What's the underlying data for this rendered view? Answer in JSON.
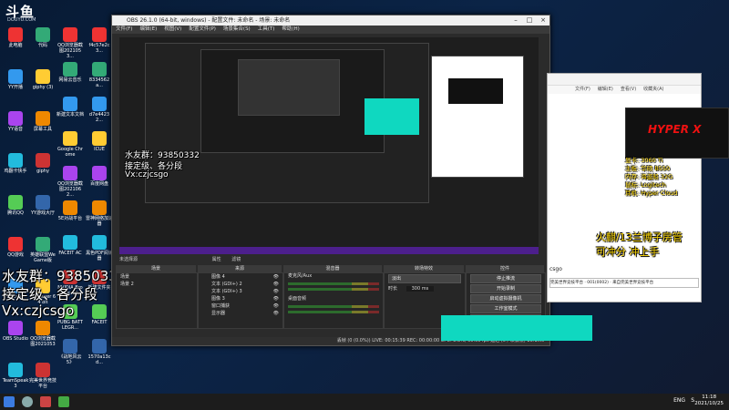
{
  "watermark": {
    "logo": "斗鱼",
    "domain": "DOUYU.COM"
  },
  "desktop_icons": [
    {
      "label": "此电脑"
    },
    {
      "label": "代码"
    },
    {
      "label": "YY开播"
    },
    {
      "label": "giphy (3)"
    },
    {
      "label": "YY语音"
    },
    {
      "label": "屏幕工具"
    },
    {
      "label": "鸡翻卡快手"
    },
    {
      "label": "giphy"
    },
    {
      "label": "腾讯QQ"
    },
    {
      "label": "YY游戏大厅"
    },
    {
      "label": "QQ游戏"
    },
    {
      "label": "英雄联盟WeGame版"
    },
    {
      "label": "Steam"
    },
    {
      "label": "PotPlayer 64 bit"
    },
    {
      "label": "OBS Studio"
    },
    {
      "label": "QQ浏览器截图2021053"
    },
    {
      "label": "TeamSpeak 3"
    },
    {
      "label": "完美世界竞技平台"
    }
  ],
  "desktop_icons_col3": [
    {
      "label": "QQ浏览器截图2021053..."
    },
    {
      "label": "网易云音乐"
    },
    {
      "label": "新建文本文档"
    },
    {
      "label": "Google Chrome"
    },
    {
      "label": "QQ浏览器截图2021062..."
    },
    {
      "label": "5E对战平台"
    },
    {
      "label": "FACEIT AC"
    },
    {
      "label": "NVIDIA Broadcast"
    },
    {
      "label": "PUBG BATTLEGR..."
    },
    {
      "label": "《战地风云 5》"
    }
  ],
  "desktop_icons_col4": [
    {
      "label": "f4c57e2c3..."
    },
    {
      "label": "8334562a..."
    },
    {
      "label": "d7e44232..."
    },
    {
      "label": "ICUE"
    },
    {
      "label": "百度网盘"
    },
    {
      "label": "雷神网络加速器"
    },
    {
      "label": "黑色PDF阅读器"
    },
    {
      "label": "新建文件夹"
    },
    {
      "label": "FACEIT"
    },
    {
      "label": "1570a13cd..."
    }
  ],
  "obs": {
    "title": "OBS 26.1.0 (64-bit, windows) - 配置文件: 未命名 - 场景: 未命名",
    "menu": [
      "文件(F)",
      "编辑(E)",
      "视图(V)",
      "配置文件(P)",
      "场景集合(S)",
      "工具(T)",
      "帮助(H)"
    ],
    "docks": {
      "scenes": "场景",
      "sources": "来源",
      "mixer": "混音器",
      "transitions": "转场特效",
      "controls": "控件"
    },
    "scene_bar_label": "未选择源",
    "scenes": [
      "场景",
      "场景 2"
    ],
    "sources": [
      "图像 4",
      "文本 (GDI+) 2",
      "文本 (GDI+) 3",
      "图像 3",
      "窗口捕获",
      "显示器"
    ],
    "toolbar": [
      "属性",
      "滤镜"
    ],
    "mixer": [
      {
        "name": "麦克风/Aux",
        "level": "0.0 dB"
      },
      {
        "name": "桌面音频",
        "level": "0.0 dB"
      }
    ],
    "transition": {
      "type": "淡出",
      "duration_label": "时长",
      "duration": "300 ms"
    },
    "controls": [
      "停止推流",
      "开始录制",
      "启动虚拟摄像机",
      "工作室模式",
      "设置",
      "退出"
    ],
    "status": "丢帧 (0 (0.0%))  LIVE: 00:15:39  REC: 00:00:00  CPU: 8.3%, 60.00 fps  延迟 (0 / 以丢帧) 16:1ms"
  },
  "overlay_left": {
    "line1": "水友群：93850332",
    "line2": "接定级、各分段",
    "line3": "Vx:czjcsgo"
  },
  "overlay_preview": {
    "line1": "水友群：93850332",
    "line2": "接定级、各分段",
    "line3": "Vx:czjcsgo"
  },
  "right_window": {
    "menu": [
      "文件(F)",
      "编辑(E)",
      "查看(V)",
      "收藏夹(A)"
    ],
    "chat_input_label": "csgo",
    "chat_line": "完美世界竞技平台 · 001(0002) · 来自完美世界竞技平台"
  },
  "hyperx": {
    "brand": "HYPER X"
  },
  "specs": [
    "显卡: 3060 Ti",
    "主板: 华硕 B550",
    "内存: 海盗船 32G",
    "鼠标: Logitech",
    "耳机: Hyper Cloud"
  ],
  "overlay_right": {
    "line1": "火麒/13兰博子房管",
    "line2": "可冲分 冲上手"
  },
  "taskbar": {
    "time": "11:18",
    "date": "2021/10/25",
    "lang": "ENG",
    "ime": "S"
  }
}
